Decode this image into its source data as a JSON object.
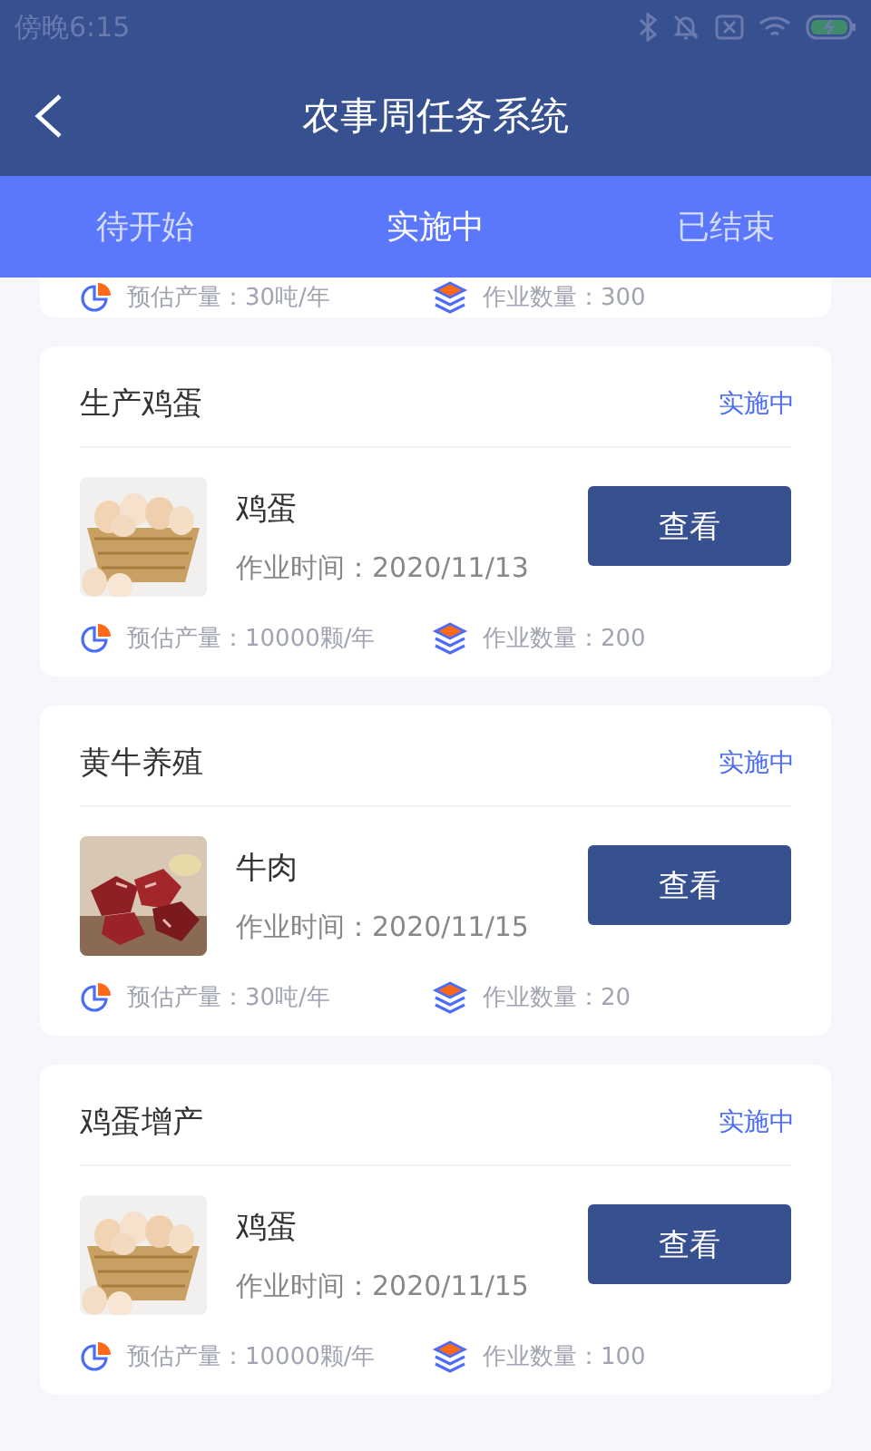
{
  "status_bar": {
    "time": "傍晚6:15"
  },
  "header": {
    "title": "农事周任务系统"
  },
  "tabs": [
    {
      "label": "待开始",
      "selected": false
    },
    {
      "label": "实施中",
      "selected": true
    },
    {
      "label": "已结束",
      "selected": false
    }
  ],
  "partial_card": {
    "yield": "预估产量：30吨/年",
    "quantity": "作业数量：300"
  },
  "tasks": [
    {
      "name": "生产鸡蛋",
      "status": "实施中",
      "product": "鸡蛋",
      "date": "作业时间：2020/11/13",
      "button": "查看",
      "yield": "预估产量：10000颗/年",
      "quantity": "作业数量：200"
    },
    {
      "name": "黄牛养殖",
      "status": "实施中",
      "product": "牛肉",
      "date": "作业时间：2020/11/15",
      "button": "查看",
      "yield": "预估产量：30吨/年",
      "quantity": "作业数量：20"
    },
    {
      "name": "鸡蛋增产",
      "status": "实施中",
      "product": "鸡蛋",
      "date": "作业时间：2020/11/15",
      "button": "查看",
      "yield": "预估产量：10000颗/年",
      "quantity": "作业数量：100"
    }
  ]
}
